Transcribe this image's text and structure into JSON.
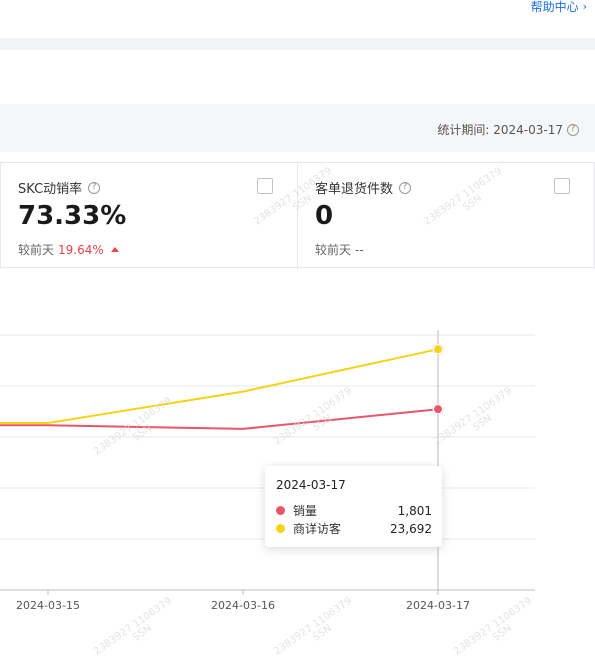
{
  "header": {
    "help_label": "帮助中心",
    "help_icon": "chevron-right-icon"
  },
  "period": {
    "label": "统计期间: 2024-03-17",
    "icon": "question-circle-icon"
  },
  "cards": [
    {
      "title": "SKC动销率",
      "value": "73.33%",
      "compare_label": "较前天",
      "compare_value": "19.64%",
      "trend": "up",
      "trend_color": "#e54545"
    },
    {
      "title": "客单退货件数",
      "value": "0",
      "compare_label": "较前天",
      "compare_value": "--"
    }
  ],
  "chart_data": {
    "type": "line",
    "x": [
      "2024-03-15",
      "2024-03-16",
      "2024-03-17"
    ],
    "series": [
      {
        "name": "销量",
        "color": "#e8566b",
        "values": [
          1710,
          1690,
          1801
        ]
      },
      {
        "name": "商详访客",
        "color": "#f5d316",
        "values": [
          19350,
          21200,
          23692
        ]
      }
    ],
    "grid": true
  },
  "tooltip": {
    "date": "2024-03-17",
    "rows": [
      {
        "name": "销量",
        "value": "1,801",
        "color": "#e8566b"
      },
      {
        "name": "商详访客",
        "value": "23,692",
        "color": "#f5d316"
      }
    ]
  },
  "watermark": {
    "line1": "2383927 1106379",
    "line2": "SSN"
  }
}
